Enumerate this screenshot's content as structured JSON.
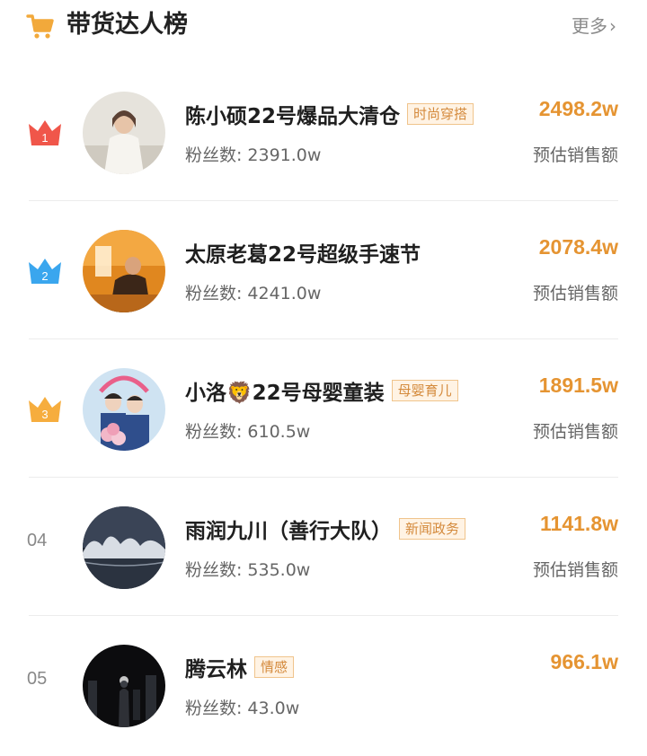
{
  "header": {
    "title": "带货达人榜",
    "more_label": "更多",
    "cart_icon": "shopping-cart-icon",
    "accent_color": "#f2a93b"
  },
  "ranking": [
    {
      "rank_label": "",
      "crown": "gold-crown",
      "crown_number": "1",
      "name": "陈小硕22号爆品大清仓",
      "tag": "时尚穿搭",
      "fans_label": "粉丝数:",
      "fans": "2391.0w",
      "amount": "2498.2w",
      "amount_label": "预估销售额"
    },
    {
      "rank_label": "",
      "crown": "blue-crown",
      "crown_number": "2",
      "name": "太原老葛22号超级手速节",
      "tag": "",
      "fans_label": "粉丝数:",
      "fans": "4241.0w",
      "amount": "2078.4w",
      "amount_label": "预估销售额"
    },
    {
      "rank_label": "",
      "crown": "orange-crown",
      "crown_number": "3",
      "name": "小洛🦁22号母婴童装",
      "tag": "母婴育儿",
      "fans_label": "粉丝数:",
      "fans": "610.5w",
      "amount": "1891.5w",
      "amount_label": "预估销售额"
    },
    {
      "rank_label": "04",
      "crown": "",
      "crown_number": "",
      "name": "雨润九川（善行大队）",
      "tag": "新闻政务",
      "fans_label": "粉丝数:",
      "fans": "535.0w",
      "amount": "1141.8w",
      "amount_label": "预估销售额"
    },
    {
      "rank_label": "05",
      "crown": "",
      "crown_number": "",
      "name": "腾云林",
      "tag": "情感",
      "fans_label": "粉丝数:",
      "fans": "43.0w",
      "amount": "966.1w",
      "amount_label": ""
    }
  ]
}
